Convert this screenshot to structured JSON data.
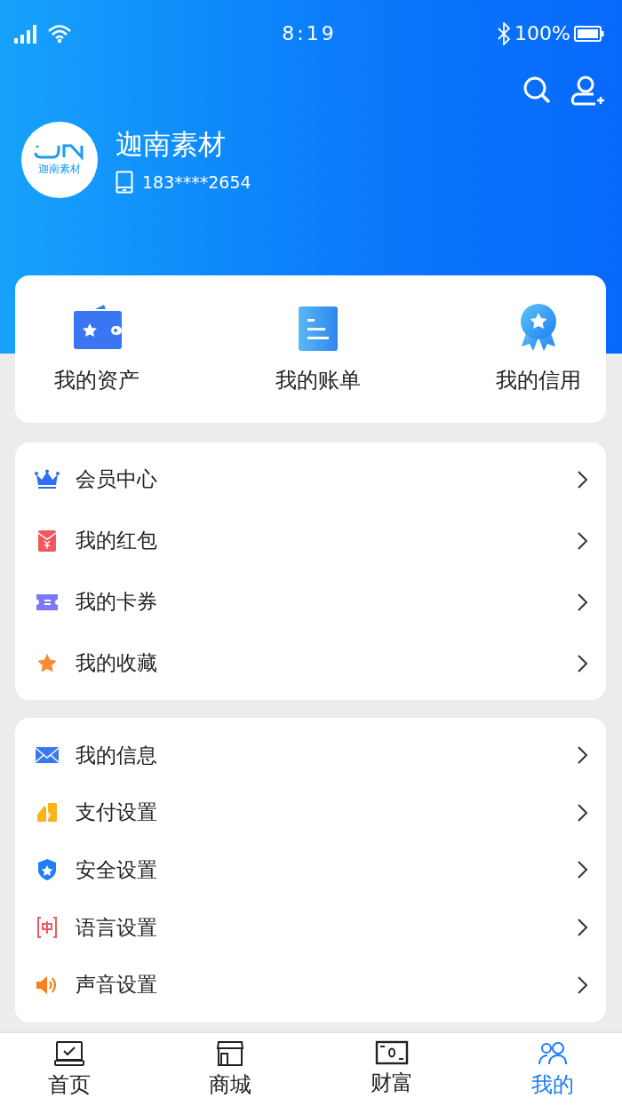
{
  "status_bar": {
    "time": "8:19",
    "battery": "100%"
  },
  "profile": {
    "logo_text": "迦南素材",
    "name": "迦南素材",
    "phone": "183****2654"
  },
  "shortcuts": [
    {
      "kind": "wallet",
      "label": "我的资产"
    },
    {
      "kind": "bill",
      "label": "我的账单"
    },
    {
      "kind": "medal",
      "label": "我的信用"
    }
  ],
  "menu_groups": [
    [
      {
        "kind": "crown",
        "label": "会员中心"
      },
      {
        "kind": "redpacket",
        "label": "我的红包"
      },
      {
        "kind": "ticket",
        "label": "我的卡券"
      },
      {
        "kind": "star",
        "label": "我的收藏"
      }
    ],
    [
      {
        "kind": "mail",
        "label": "我的信息"
      },
      {
        "kind": "pay",
        "label": "支付设置"
      },
      {
        "kind": "shield",
        "label": "安全设置"
      },
      {
        "kind": "language",
        "label": "语言设置"
      },
      {
        "kind": "sound",
        "label": "声音设置"
      }
    ]
  ],
  "tab_bar": [
    {
      "kind": "home",
      "label": "首页",
      "selected": false
    },
    {
      "kind": "shop",
      "label": "商城",
      "selected": false
    },
    {
      "kind": "money",
      "label": "财富",
      "selected": false
    },
    {
      "kind": "people",
      "label": "我的",
      "selected": true
    }
  ]
}
